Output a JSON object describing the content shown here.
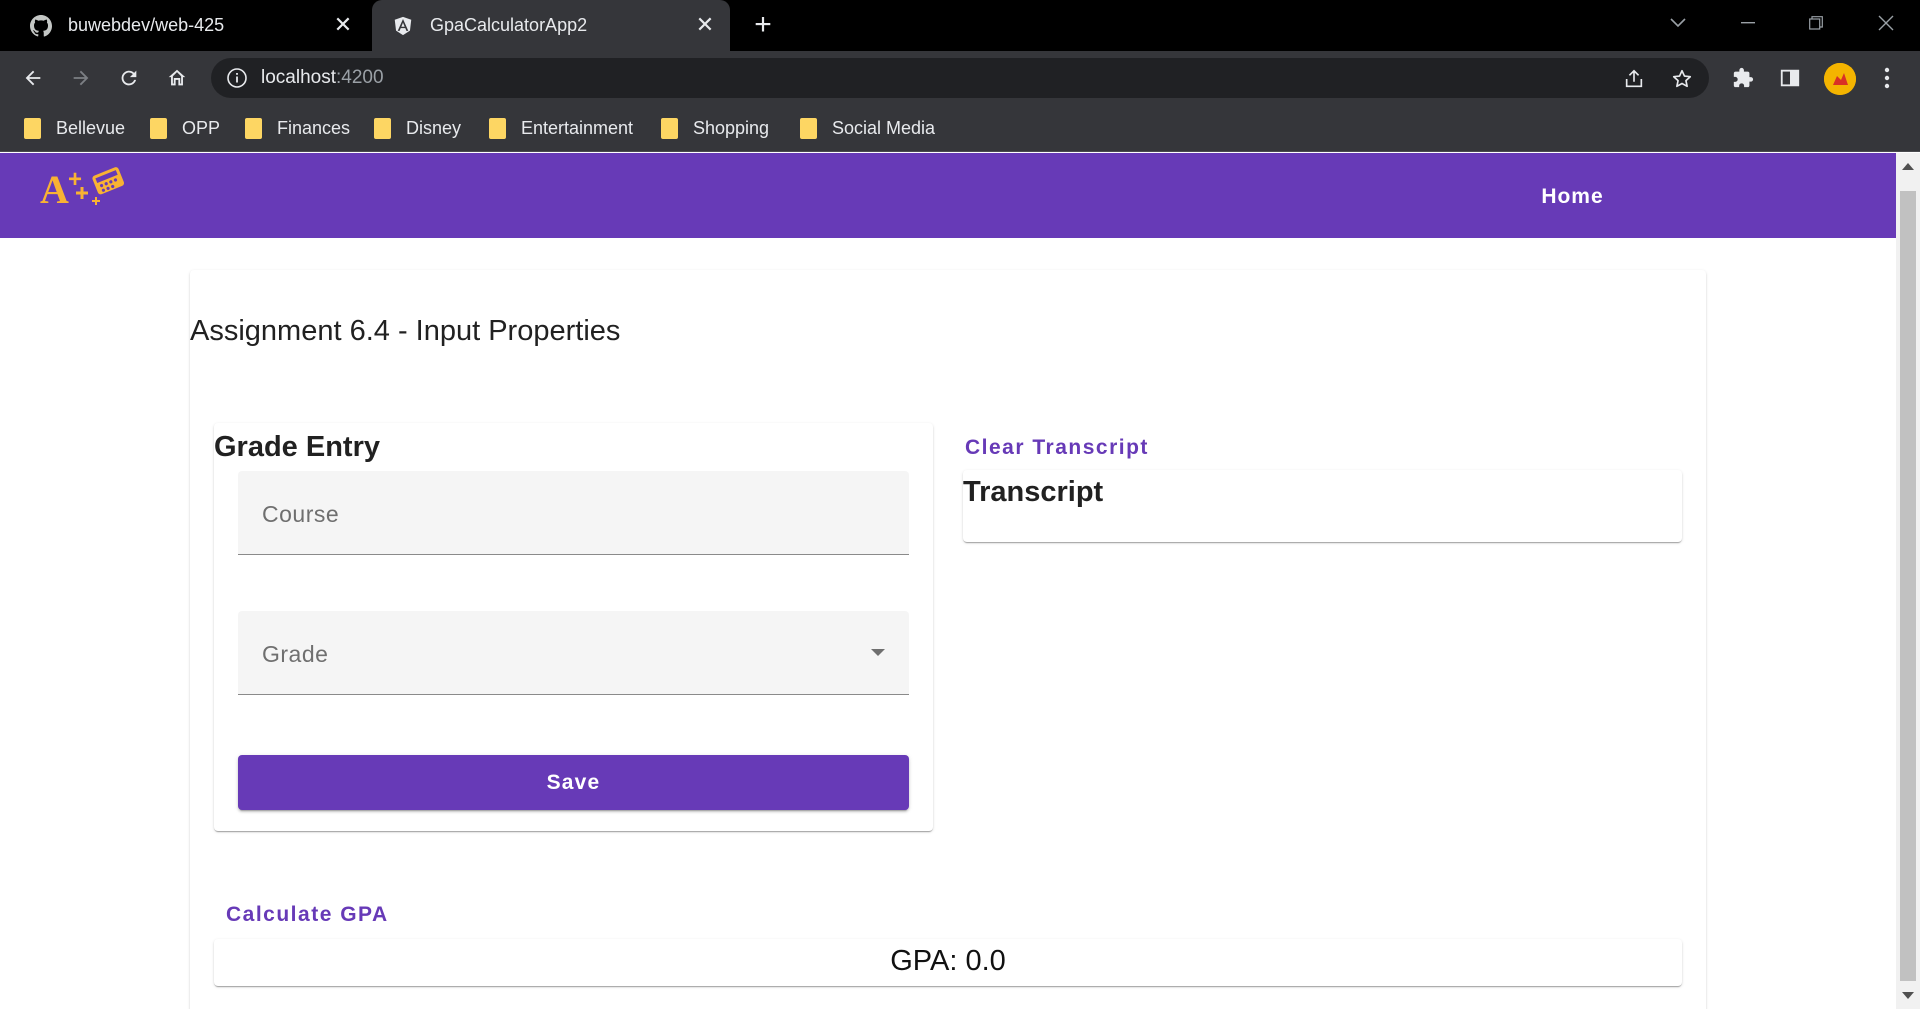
{
  "browser": {
    "tabs": [
      {
        "title": "buwebdev/web-425",
        "icon": "github-icon"
      },
      {
        "title": "GpaCalculatorApp2",
        "icon": "angular-icon"
      }
    ],
    "url": {
      "host": "localhost",
      "port": ":4200"
    },
    "bookmarks": [
      "Bellevue",
      "OPP",
      "Finances",
      "Disney",
      "Entertainment",
      "Shopping",
      "Social Media"
    ]
  },
  "app": {
    "nav": {
      "home_label": "Home"
    },
    "page_title": "Assignment 6.4 - Input Properties",
    "grade_entry": {
      "title": "Grade Entry",
      "course_placeholder": "Course",
      "grade_placeholder": "Grade",
      "save_label": "Save"
    },
    "transcript": {
      "clear_label": "Clear Transcript",
      "title": "Transcript"
    },
    "gpa": {
      "calculate_label": "Calculate GPA",
      "display": "GPA: 0.0"
    }
  },
  "colors": {
    "primary": "#673ab7",
    "logo_gold": "#f9b233"
  }
}
